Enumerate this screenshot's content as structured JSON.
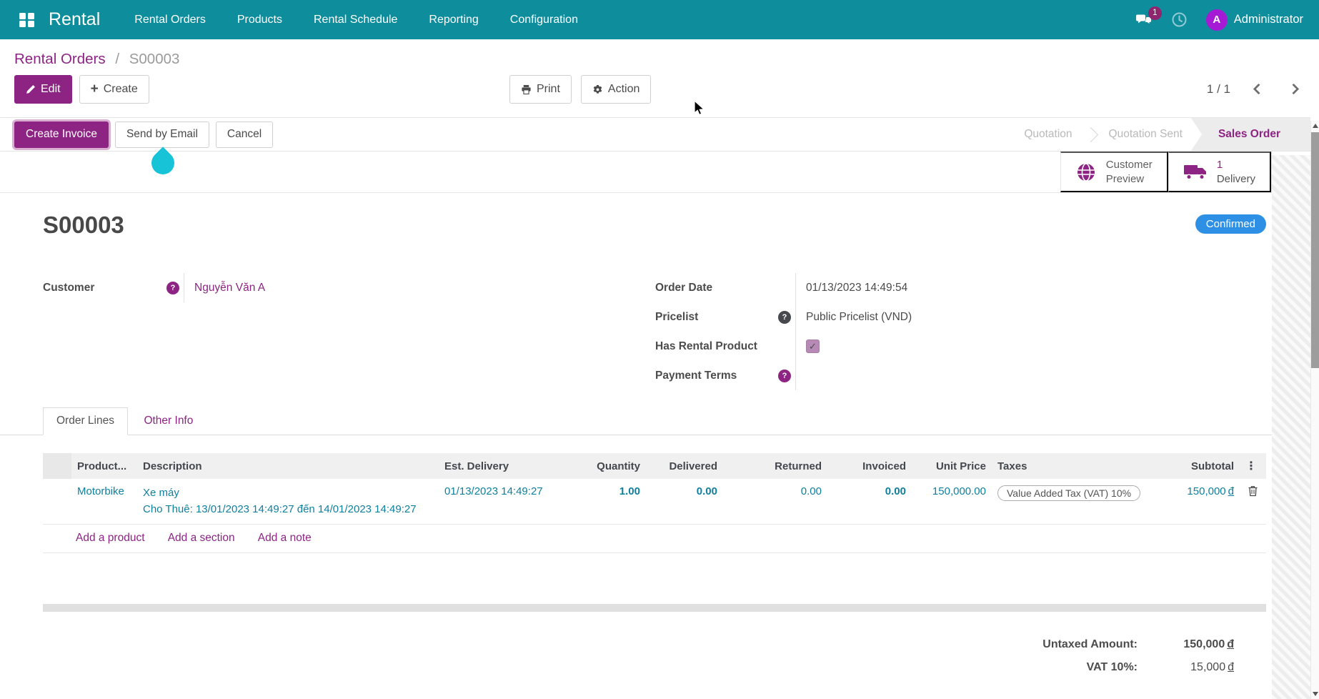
{
  "nav": {
    "brand": "Rental",
    "items": [
      {
        "label": "Rental Orders"
      },
      {
        "label": "Products"
      },
      {
        "label": "Rental Schedule"
      },
      {
        "label": "Reporting"
      },
      {
        "label": "Configuration"
      }
    ],
    "messages_badge": "1",
    "user": {
      "initial": "A",
      "name": "Administrator"
    }
  },
  "breadcrumb": {
    "parent": "Rental Orders",
    "separator": "/",
    "current": "S00003"
  },
  "controls": {
    "edit": "Edit",
    "create": "Create",
    "print": "Print",
    "action": "Action",
    "pager": "1 / 1"
  },
  "statusbar": {
    "create_invoice": "Create Invoice",
    "send_by_email": "Send by Email",
    "cancel": "Cancel",
    "steps": [
      {
        "label": "Quotation",
        "active": false
      },
      {
        "label": "Quotation Sent",
        "active": false
      },
      {
        "label": "Sales Order",
        "active": true
      }
    ]
  },
  "smart_buttons": {
    "customer_preview_line1": "Customer",
    "customer_preview_line2": "Preview",
    "delivery_count": "1",
    "delivery_label": "Delivery"
  },
  "form": {
    "title": "S00003",
    "status_badge": "Confirmed",
    "customer": {
      "label": "Customer",
      "value": "Nguyễn Văn A"
    },
    "order_date": {
      "label": "Order Date",
      "value": "01/13/2023 14:49:54"
    },
    "pricelist": {
      "label": "Pricelist",
      "value": "Public Pricelist (VND)"
    },
    "has_rental_product": {
      "label": "Has Rental Product",
      "checked": true
    },
    "payment_terms": {
      "label": "Payment Terms",
      "value": ""
    }
  },
  "tabs": {
    "order_lines": "Order Lines",
    "other_info": "Other Info"
  },
  "order_lines": {
    "headers": {
      "product": "Product...",
      "description": "Description",
      "est_delivery": "Est. Delivery",
      "quantity": "Quantity",
      "delivered": "Delivered",
      "returned": "Returned",
      "invoiced": "Invoiced",
      "unit_price": "Unit Price",
      "taxes": "Taxes",
      "subtotal": "Subtotal"
    },
    "row": {
      "product": "Motorbike",
      "description_name": "Xe máy",
      "description_rental": "Cho Thuê: 13/01/2023 14:49:27 đến 14/01/2023 14:49:27",
      "est_delivery": "01/13/2023 14:49:27",
      "quantity": "1.00",
      "delivered": "0.00",
      "returned": "0.00",
      "invoiced": "0.00",
      "unit_price": "150,000.00",
      "taxes": "Value Added Tax (VAT) 10%",
      "subtotal_amount": "150,000",
      "currency": "đ"
    },
    "links": {
      "add_product": "Add a product",
      "add_section": "Add a section",
      "add_note": "Add a note"
    }
  },
  "totals": {
    "untaxed_label": "Untaxed Amount:",
    "untaxed_amount": "150,000",
    "vat_label": "VAT 10%:",
    "vat_amount": "15,000",
    "currency": "đ"
  },
  "colors": {
    "topbar_teal": "#0e8d9d",
    "accent_purple": "#8d2483",
    "link_teal": "#0f7f9e",
    "confirmed_badge_blue": "#2e90e5",
    "drop_cyan": "#16c3d7",
    "avatar_purple": "#a51ad5",
    "badge_magenta": "#8f246f"
  }
}
